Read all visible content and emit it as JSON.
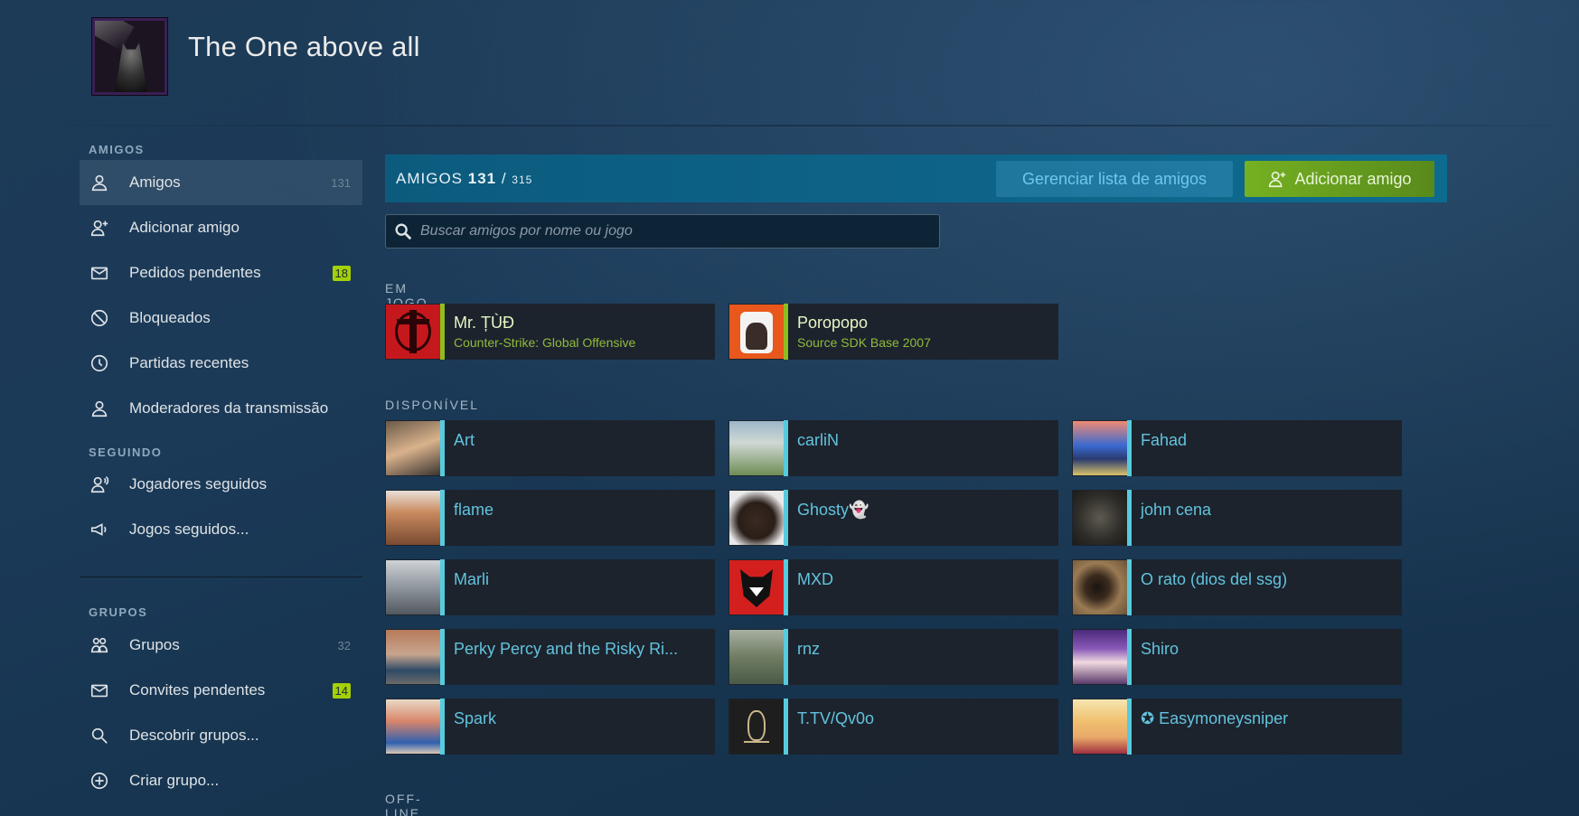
{
  "profile": {
    "name": "The One above all"
  },
  "sidebar": {
    "sections": {
      "friends": "AMIGOS",
      "following": "SEGUINDO",
      "groups": "GRUPOS"
    },
    "items": [
      {
        "label": "Amigos",
        "count": "131"
      },
      {
        "label": "Adicionar amigo"
      },
      {
        "label": "Pedidos pendentes",
        "badge": "18"
      },
      {
        "label": "Bloqueados"
      },
      {
        "label": "Partidas recentes"
      },
      {
        "label": "Moderadores da transmissão"
      },
      {
        "label": "Jogadores seguidos"
      },
      {
        "label": "Jogos seguidos..."
      },
      {
        "label": "Grupos",
        "count": "32"
      },
      {
        "label": "Convites pendentes",
        "badge": "14"
      },
      {
        "label": "Descobrir grupos..."
      },
      {
        "label": "Criar grupo..."
      }
    ]
  },
  "header_bar": {
    "title": "AMIGOS",
    "count": "131",
    "separator": " / ",
    "limit": "315",
    "manage_label": "Gerenciar lista de amigos",
    "add_label": "Adicionar amigo"
  },
  "search": {
    "placeholder": "Buscar amigos por nome ou jogo"
  },
  "groups": {
    "in_game": "EM JOGO",
    "online": "DISPONÍVEL",
    "offline": "OFF-LINE"
  },
  "in_game": [
    {
      "name": "Mr. ȚÙĐ",
      "game": "Counter-Strike: Global Offensive"
    },
    {
      "name": "Poropopo",
      "game": "Source SDK Base 2007"
    }
  ],
  "online": [
    {
      "name": "Art"
    },
    {
      "name": "carliN"
    },
    {
      "name": "Fahad"
    },
    {
      "name": "flame"
    },
    {
      "name": "Ghosty👻"
    },
    {
      "name": "john cena"
    },
    {
      "name": "Marli"
    },
    {
      "name": "MXD"
    },
    {
      "name": "O rato (dios del ssg)"
    },
    {
      "name": "Perky Percy and the Risky Ri..."
    },
    {
      "name": "rnz"
    },
    {
      "name": "Shiro"
    },
    {
      "name": "Spark"
    },
    {
      "name": "T.TV/Qv0o"
    },
    {
      "name": "✪ Easymoneysniper"
    }
  ],
  "colors": {
    "ingame_stripe": "#8fbc1e",
    "online_stripe": "#57cbde",
    "badge": "#a4d007",
    "add_button": "#75b022"
  }
}
